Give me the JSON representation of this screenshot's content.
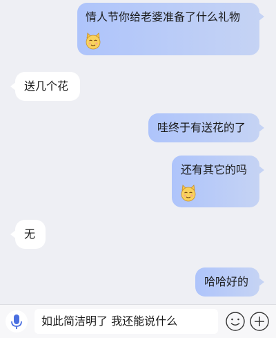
{
  "messages": [
    {
      "direction": "out",
      "text": "情人节你给老婆准备了什么礼物",
      "emoji": "smiling-cat-face"
    },
    {
      "direction": "in",
      "text": "送几个花"
    },
    {
      "direction": "out",
      "text": "哇终于有送花的了"
    },
    {
      "direction": "out",
      "text": "还有其它的吗",
      "emoji": "smiling-cat-face"
    },
    {
      "direction": "in",
      "text": "无"
    },
    {
      "direction": "out",
      "text": "哈哈好的"
    }
  ],
  "composer": {
    "input_value": "如此简洁明了 我还能说什么",
    "left_icon": "microphone-icon",
    "right_icons": [
      "emoji-icon",
      "plus-icon"
    ]
  },
  "colors": {
    "background": "#eeeff4",
    "incoming_bubble": "#ffffff",
    "outgoing_bubble": "#b9cbf6",
    "accent": "#4a6fe0"
  }
}
